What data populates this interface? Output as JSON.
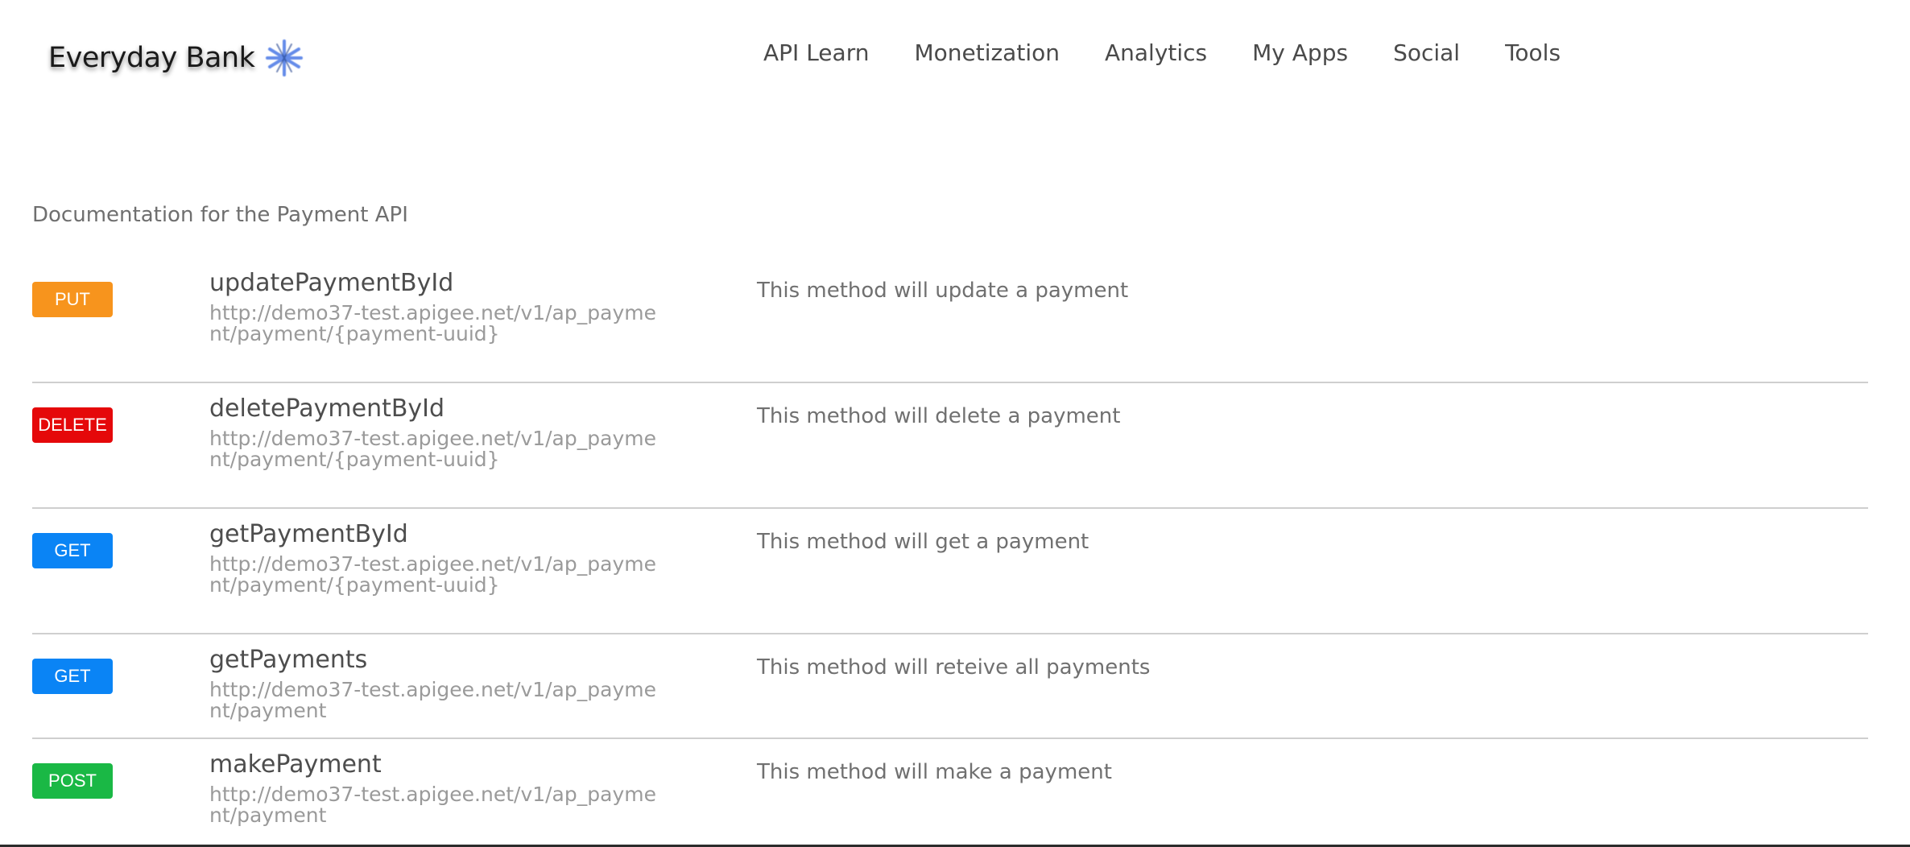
{
  "header": {
    "logo_text": "Everyday Bank",
    "logo_icon": "snowflake-star-icon",
    "nav": [
      {
        "label": "API Learn"
      },
      {
        "label": "Monetization"
      },
      {
        "label": "Analytics"
      },
      {
        "label": "My Apps"
      },
      {
        "label": "Social"
      },
      {
        "label": "Tools"
      }
    ]
  },
  "main": {
    "title": "Documentation for the Payment API",
    "operations": [
      {
        "method": "PUT",
        "method_color": "#f7941d",
        "name": "updatePaymentById",
        "url": "http://demo37-test.apigee.net/v1/ap_payment/payment/{payment-uuid}",
        "description": "This method will update a payment"
      },
      {
        "method": "DELETE",
        "method_color": "#e5080a",
        "name": "deletePaymentById",
        "url": "http://demo37-test.apigee.net/v1/ap_payment/payment/{payment-uuid}",
        "description": "This method will delete a payment"
      },
      {
        "method": "GET",
        "method_color": "#0a84f5",
        "name": "getPaymentById",
        "url": "http://demo37-test.apigee.net/v1/ap_payment/payment/{payment-uuid}",
        "description": "This method will get a payment"
      },
      {
        "method": "GET",
        "method_color": "#0a84f5",
        "name": "getPayments",
        "url": "http://demo37-test.apigee.net/v1/ap_payment/payment",
        "description": "This method will reteive all payments"
      },
      {
        "method": "POST",
        "method_color": "#1ab845",
        "name": "makePayment",
        "url": "http://demo37-test.apigee.net/v1/ap_payment/payment",
        "description": "This method will make a payment"
      }
    ]
  }
}
